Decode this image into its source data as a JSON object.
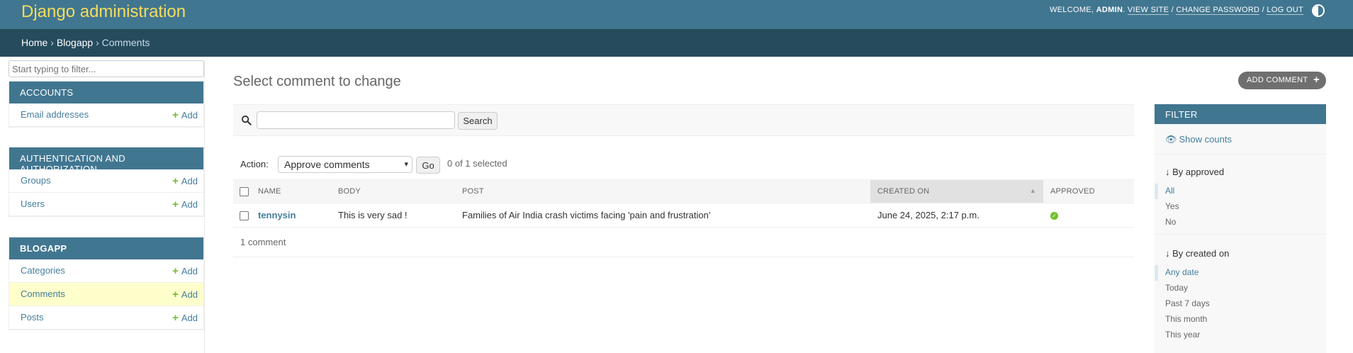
{
  "header": {
    "site_name": "Django administration",
    "welcome": "Welcome,",
    "user": "admin",
    "view_site": "View site",
    "change_password": "Change password",
    "log_out": "Log out",
    "sep1": "/",
    "sep2": "/"
  },
  "breadcrumbs": {
    "home": "Home",
    "app": "Blogapp",
    "current": "Comments",
    "sep": "›"
  },
  "sidebar": {
    "filter_placeholder": "Start typing to filter...",
    "add_label": "Add",
    "modules": [
      {
        "caption": "Accounts",
        "models": [
          "Email addresses"
        ]
      },
      {
        "caption": "Authentication and Authorization",
        "models": [
          "Groups",
          "Users"
        ]
      },
      {
        "caption": "Blogapp",
        "models": [
          "Categories",
          "Comments",
          "Posts"
        ]
      }
    ]
  },
  "main": {
    "title": "Select comment to change",
    "add_button": "Add comment",
    "search_button": "Search",
    "search_value": "",
    "action_label": "Action:",
    "action_selected": "Approve comments",
    "go_button": "Go",
    "selected_count": "0 of 1 selected",
    "columns": [
      "Name",
      "Body",
      "Post",
      "Created on",
      "Approved"
    ],
    "rows": [
      {
        "name": "tennysin",
        "body": "This is very sad !",
        "post": "Families of Air India crash victims facing 'pain and frustration'",
        "created_on": "June 24, 2025, 2:17 p.m.",
        "approved": true
      }
    ],
    "paginator": "1 comment"
  },
  "filter": {
    "title": "Filter",
    "show_counts": "Show counts",
    "by_approved": "↓ By approved",
    "approved_options": [
      "All",
      "Yes",
      "No"
    ],
    "by_created": "↓ By created on",
    "created_options": [
      "Any date",
      "Today",
      "Past 7 days",
      "This month",
      "This year"
    ]
  },
  "colors": {
    "header": "#417690",
    "breadcrumbs": "#264b5d",
    "site_name": "#f5dd5d",
    "link": "#447e9b",
    "add_green": "#70bf2b",
    "current_row": "#ffffcc"
  }
}
